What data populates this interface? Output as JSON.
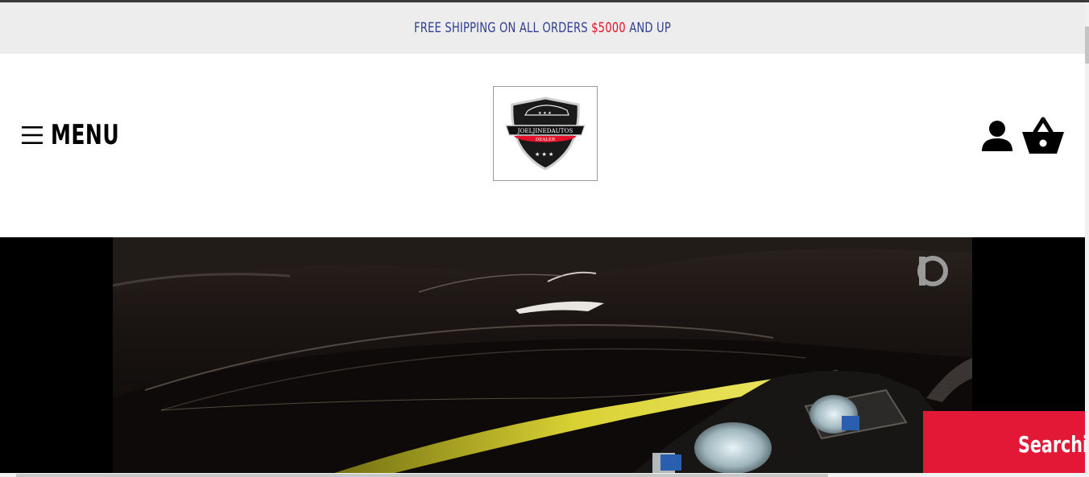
{
  "announcement": {
    "prefix": "FREE SHIPPING ON ALL ORDERS ",
    "amount": "$5000",
    "suffix": " AND UP"
  },
  "header": {
    "menu_label": "MENU",
    "menu_icon": "hamburger-icon",
    "logo": {
      "name": "JOELJINEDAUTOS",
      "tagline": "DEALER"
    },
    "account_icon": "user-icon",
    "cart_icon": "basket-icon"
  },
  "hero": {
    "video_watermark_icon": "play-logo-icon"
  },
  "search_tab": {
    "label": "Searchi"
  },
  "colors": {
    "announcement_text": "#2f3e8f",
    "announcement_amount": "#e3122a",
    "search_tab_bg": "#e31837"
  }
}
